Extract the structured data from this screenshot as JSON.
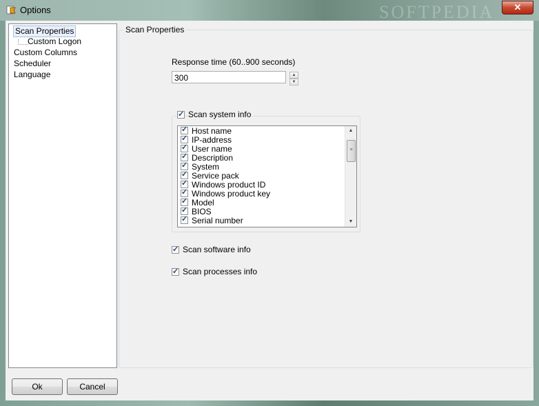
{
  "window": {
    "title": "Options",
    "close_glyph": "✕"
  },
  "watermark": "SOFTPEDIA",
  "tree": {
    "items": [
      {
        "label": "Scan Properties"
      },
      {
        "label": "Custom Logon"
      },
      {
        "label": "Custom Columns"
      },
      {
        "label": "Scheduler"
      },
      {
        "label": "Language"
      }
    ]
  },
  "panel": {
    "group_title": "Scan Properties",
    "response_label": "Response time (60..900 seconds)",
    "response_value": "300",
    "scan_system_label": "Scan system info",
    "scan_system_checked": true,
    "system_items": [
      "Host name",
      "IP-address",
      "User name",
      "Description",
      "System",
      "Service pack",
      "Windows product ID",
      "Windows product key",
      "Model",
      "BIOS",
      "Serial number"
    ],
    "scan_software_label": "Scan software info",
    "scan_software_checked": true,
    "scan_processes_label": "Scan processes info",
    "scan_processes_checked": true
  },
  "buttons": {
    "ok": "Ok",
    "cancel": "Cancel"
  }
}
